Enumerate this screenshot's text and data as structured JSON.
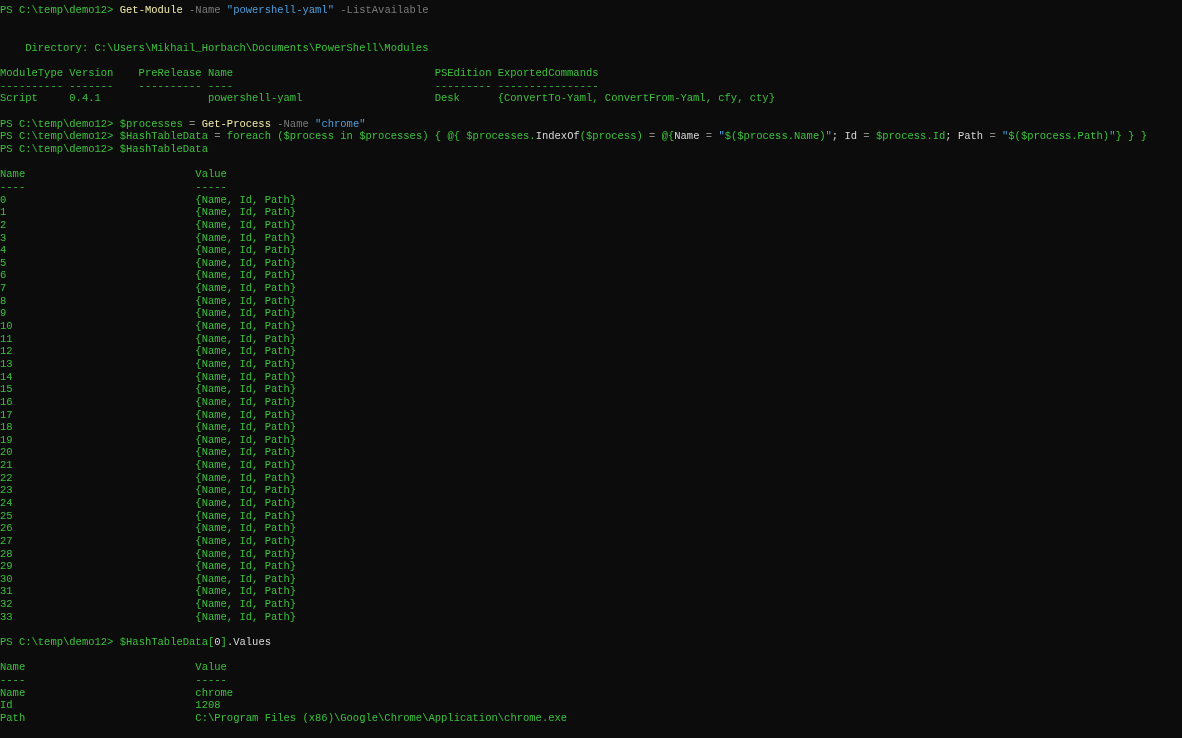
{
  "terminal": {
    "lines": [
      {
        "kind": "command",
        "segments": [
          {
            "kind": "prompt",
            "text": "PS C:\\temp\\demo12> "
          },
          {
            "kind": "cmdlet",
            "text": "Get-Module"
          },
          {
            "kind": "param",
            "text": " -Name "
          },
          {
            "kind": "string",
            "text": "\"powershell-yaml\""
          },
          {
            "kind": "param",
            "text": " -ListAvailable"
          }
        ]
      },
      {
        "kind": "blank"
      },
      {
        "kind": "blank"
      },
      {
        "kind": "output",
        "text": "    Directory: C:\\Users\\Mikhail_Horbach\\Documents\\PowerShell\\Modules"
      },
      {
        "kind": "blank"
      },
      {
        "kind": "header",
        "cells": [
          "ModuleType",
          "Version",
          "PreRelease",
          "Name",
          "PSEdition",
          "ExportedCommands"
        ]
      },
      {
        "kind": "rule",
        "cells": [
          "----------",
          "-------",
          "----------",
          "----",
          "---------",
          "----------------"
        ]
      },
      {
        "kind": "row",
        "cells": [
          "Script",
          "0.4.1",
          null,
          "powershell-yaml",
          "Desk",
          "{ConvertTo-Yaml, ConvertFrom-Yaml, cfy, cty}"
        ]
      },
      {
        "kind": "blank"
      },
      {
        "kind": "command",
        "segments": [
          {
            "kind": "prompt",
            "text": "PS C:\\temp\\demo12> "
          },
          {
            "kind": "var",
            "text": "$processes"
          },
          {
            "kind": "op",
            "text": " = "
          },
          {
            "kind": "cmdlet",
            "text": "Get-Process"
          },
          {
            "kind": "param",
            "text": " -Name "
          },
          {
            "kind": "string",
            "text": "\"chrome\""
          }
        ]
      },
      {
        "kind": "command",
        "segments": [
          {
            "kind": "prompt",
            "text": "PS C:\\temp\\demo12> "
          },
          {
            "kind": "var",
            "text": "$HashTableData"
          },
          {
            "kind": "op",
            "text": " = "
          },
          {
            "kind": "var",
            "text": "foreach ($process in $processes) { @{ $processes."
          },
          {
            "kind": "plain",
            "text": "IndexOf"
          },
          {
            "kind": "var",
            "text": "($process)"
          },
          {
            "kind": "op",
            "text": " = "
          },
          {
            "kind": "var",
            "text": "@{"
          },
          {
            "kind": "plain",
            "text": "Name"
          },
          {
            "kind": "op",
            "text": " = "
          },
          {
            "kind": "string",
            "text": "\""
          },
          {
            "kind": "var",
            "text": "$($process.Name)"
          },
          {
            "kind": "string",
            "text": "\""
          },
          {
            "kind": "plain",
            "text": "; Id"
          },
          {
            "kind": "op",
            "text": " = "
          },
          {
            "kind": "var",
            "text": "$process.Id"
          },
          {
            "kind": "plain",
            "text": "; Path"
          },
          {
            "kind": "op",
            "text": " = "
          },
          {
            "kind": "string",
            "text": "\""
          },
          {
            "kind": "var",
            "text": "$($process.Path)"
          },
          {
            "kind": "string",
            "text": "\""
          },
          {
            "kind": "var",
            "text": "} } }"
          }
        ]
      },
      {
        "kind": "command",
        "segments": [
          {
            "kind": "prompt",
            "text": "PS C:\\temp\\demo12> "
          },
          {
            "kind": "var",
            "text": "$HashTableData"
          }
        ]
      },
      {
        "kind": "blank"
      },
      {
        "kind": "header",
        "cells": [
          "Name",
          "Value"
        ]
      },
      {
        "kind": "rule",
        "cells": [
          "----",
          "-----"
        ]
      },
      {
        "kind": "row",
        "cells": [
          "0",
          "{Name, Id, Path}"
        ]
      },
      {
        "kind": "row",
        "cells": [
          "1",
          "{Name, Id, Path}"
        ]
      },
      {
        "kind": "row",
        "cells": [
          "2",
          "{Name, Id, Path}"
        ]
      },
      {
        "kind": "row",
        "cells": [
          "3",
          "{Name, Id, Path}"
        ]
      },
      {
        "kind": "row",
        "cells": [
          "4",
          "{Name, Id, Path}"
        ]
      },
      {
        "kind": "row",
        "cells": [
          "5",
          "{Name, Id, Path}"
        ]
      },
      {
        "kind": "row",
        "cells": [
          "6",
          "{Name, Id, Path}"
        ]
      },
      {
        "kind": "row",
        "cells": [
          "7",
          "{Name, Id, Path}"
        ]
      },
      {
        "kind": "row",
        "cells": [
          "8",
          "{Name, Id, Path}"
        ]
      },
      {
        "kind": "row",
        "cells": [
          "9",
          "{Name, Id, Path}"
        ]
      },
      {
        "kind": "row",
        "cells": [
          "10",
          "{Name, Id, Path}"
        ]
      },
      {
        "kind": "row",
        "cells": [
          "11",
          "{Name, Id, Path}"
        ]
      },
      {
        "kind": "row",
        "cells": [
          "12",
          "{Name, Id, Path}"
        ]
      },
      {
        "kind": "row",
        "cells": [
          "13",
          "{Name, Id, Path}"
        ]
      },
      {
        "kind": "row",
        "cells": [
          "14",
          "{Name, Id, Path}"
        ]
      },
      {
        "kind": "row",
        "cells": [
          "15",
          "{Name, Id, Path}"
        ]
      },
      {
        "kind": "row",
        "cells": [
          "16",
          "{Name, Id, Path}"
        ]
      },
      {
        "kind": "row",
        "cells": [
          "17",
          "{Name, Id, Path}"
        ]
      },
      {
        "kind": "row",
        "cells": [
          "18",
          "{Name, Id, Path}"
        ]
      },
      {
        "kind": "row",
        "cells": [
          "19",
          "{Name, Id, Path}"
        ]
      },
      {
        "kind": "row",
        "cells": [
          "20",
          "{Name, Id, Path}"
        ]
      },
      {
        "kind": "row",
        "cells": [
          "21",
          "{Name, Id, Path}"
        ]
      },
      {
        "kind": "row",
        "cells": [
          "22",
          "{Name, Id, Path}"
        ]
      },
      {
        "kind": "row",
        "cells": [
          "23",
          "{Name, Id, Path}"
        ]
      },
      {
        "kind": "row",
        "cells": [
          "24",
          "{Name, Id, Path}"
        ]
      },
      {
        "kind": "row",
        "cells": [
          "25",
          "{Name, Id, Path}"
        ]
      },
      {
        "kind": "row",
        "cells": [
          "26",
          "{Name, Id, Path}"
        ]
      },
      {
        "kind": "row",
        "cells": [
          "27",
          "{Name, Id, Path}"
        ]
      },
      {
        "kind": "row",
        "cells": [
          "28",
          "{Name, Id, Path}"
        ]
      },
      {
        "kind": "row",
        "cells": [
          "29",
          "{Name, Id, Path}"
        ]
      },
      {
        "kind": "row",
        "cells": [
          "30",
          "{Name, Id, Path}"
        ]
      },
      {
        "kind": "row",
        "cells": [
          "31",
          "{Name, Id, Path}"
        ]
      },
      {
        "kind": "row",
        "cells": [
          "32",
          "{Name, Id, Path}"
        ]
      },
      {
        "kind": "row",
        "cells": [
          "33",
          "{Name, Id, Path}"
        ]
      },
      {
        "kind": "blank"
      },
      {
        "kind": "command",
        "segments": [
          {
            "kind": "prompt",
            "text": "PS C:\\temp\\demo12> "
          },
          {
            "kind": "var",
            "text": "$HashTableData["
          },
          {
            "kind": "plain",
            "text": "0"
          },
          {
            "kind": "var",
            "text": "]"
          },
          {
            "kind": "plain",
            "text": ".Values"
          }
        ]
      },
      {
        "kind": "blank"
      },
      {
        "kind": "header",
        "cells": [
          "Name",
          "Value"
        ]
      },
      {
        "kind": "rule",
        "cells": [
          "----",
          "-----"
        ]
      },
      {
        "kind": "row",
        "cells": [
          "Name",
          "chrome"
        ]
      },
      {
        "kind": "row",
        "cells": [
          "Id",
          "1208"
        ]
      },
      {
        "kind": "row",
        "cells": [
          "Path",
          "C:\\Program Files (x86)\\Google\\Chrome\\Application\\chrome.exe"
        ]
      }
    ]
  }
}
